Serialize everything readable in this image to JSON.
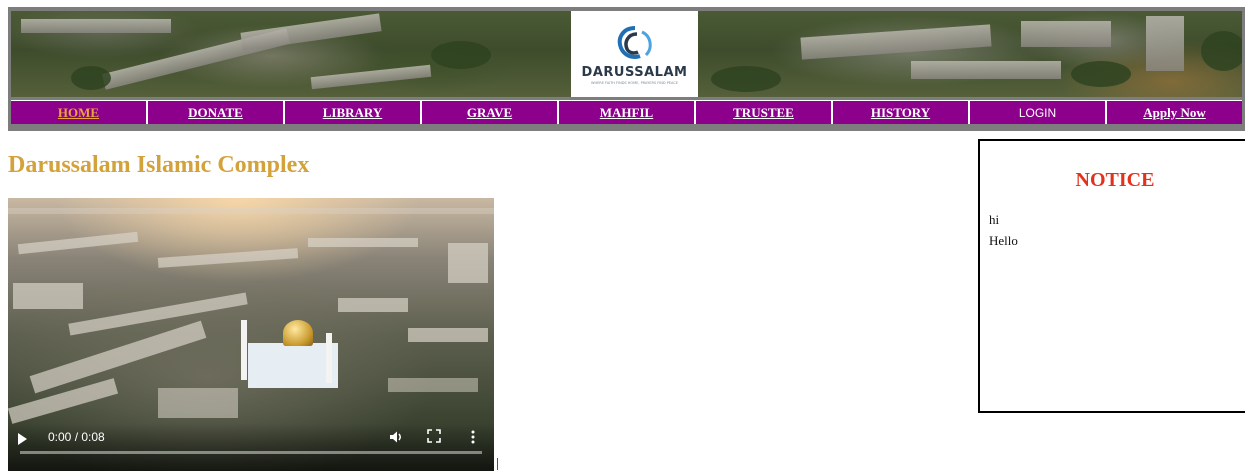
{
  "header": {
    "logo": {
      "title": "DARUSSALAM",
      "tagline": "WHERE FAITH FINDS HOME, PRAYERS FIND PEACE"
    },
    "nav": [
      {
        "label": "HOME",
        "active": true
      },
      {
        "label": "DONATE"
      },
      {
        "label": "LIBRARY"
      },
      {
        "label": "GRAVE"
      },
      {
        "label": "MAHFIL"
      },
      {
        "label": "TRUSTEE"
      },
      {
        "label": "HISTORY"
      },
      {
        "label": "LOGIN"
      },
      {
        "label": "Apply Now"
      }
    ]
  },
  "main": {
    "title": "Darussalam Islamic Complex",
    "video": {
      "time": "0:00 / 0:08",
      "progress": 0
    }
  },
  "notice": {
    "title": "NOTICE",
    "items": [
      "hi",
      "Hello"
    ]
  },
  "colors": {
    "nav_bg": "#8c008c",
    "title_gold": "#d4a23a",
    "notice_red": "#e2321d",
    "active_nav": "#e8a53c"
  }
}
